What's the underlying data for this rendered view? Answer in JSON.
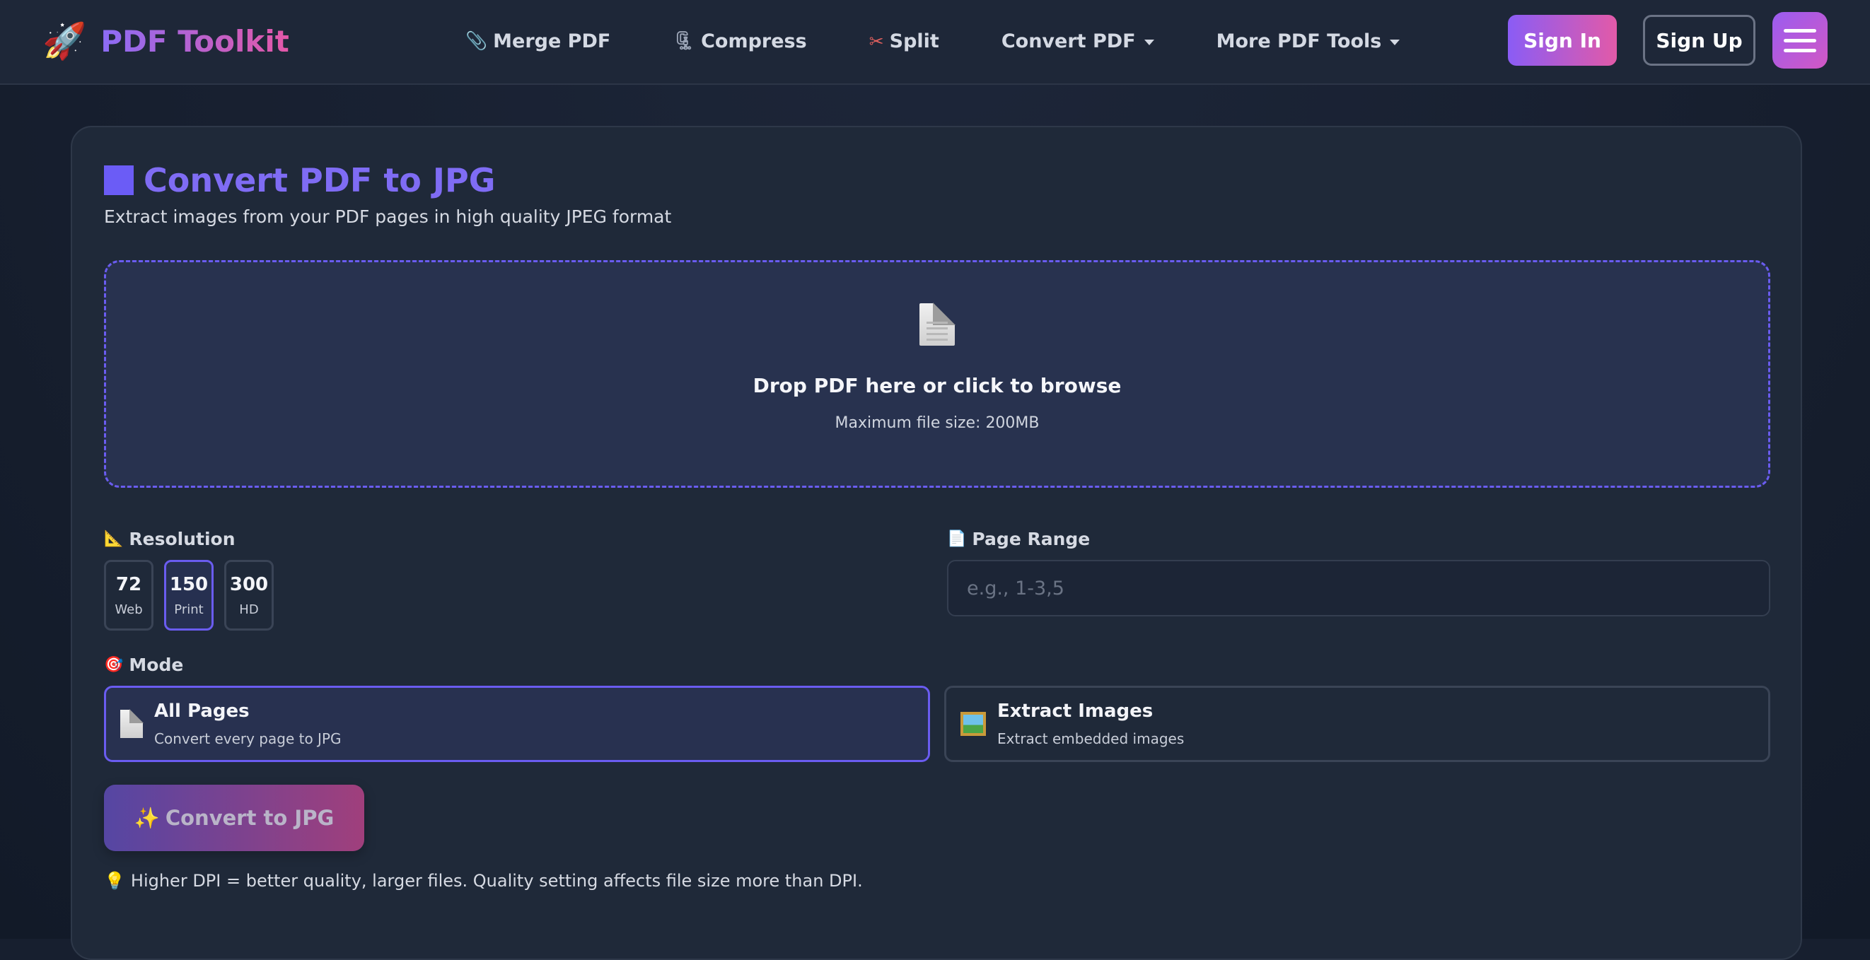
{
  "nav": {
    "brand_icon": "🚀",
    "brand_name": "PDF Toolkit",
    "links": [
      {
        "icon": "📎",
        "label": "Merge PDF"
      },
      {
        "icon": "🗜",
        "label": "Compress"
      },
      {
        "icon": "✂",
        "label": "Split"
      },
      {
        "label": "Convert PDF",
        "dropdown": true
      },
      {
        "label": "More PDF Tools",
        "dropdown": true
      }
    ],
    "sign_in": "Sign In",
    "sign_up": "Sign Up"
  },
  "page": {
    "title": "Convert PDF to JPG",
    "subtitle": "Extract images from your PDF pages in high quality JPEG format"
  },
  "dropzone": {
    "title": "Drop PDF here or click to browse",
    "subtitle": "Maximum file size: 200MB"
  },
  "resolution": {
    "icon": "📐",
    "label": "Resolution",
    "options": [
      {
        "value": "72",
        "label": "Web"
      },
      {
        "value": "150",
        "label": "Print",
        "selected": true
      },
      {
        "value": "300",
        "label": "HD"
      }
    ]
  },
  "page_range": {
    "icon": "📄",
    "label": "Page Range",
    "value": "",
    "placeholder": "e.g., 1-3,5"
  },
  "mode": {
    "icon": "🎯",
    "label": "Mode",
    "options": [
      {
        "title": "All Pages",
        "desc": "Convert every page to JPG",
        "selected": true
      },
      {
        "title": "Extract Images",
        "desc": "Extract embedded images"
      }
    ]
  },
  "convert_button": {
    "icon": "✨",
    "label": "Convert to JPG"
  },
  "tip": {
    "icon": "💡",
    "text": "Higher DPI = better quality, larger files. Quality setting affects file size more than DPI."
  },
  "colors": {
    "accent": "#6b5cf6",
    "brand_pink": "#e458a8",
    "background": "#171f2f",
    "card": "#1f2939"
  }
}
